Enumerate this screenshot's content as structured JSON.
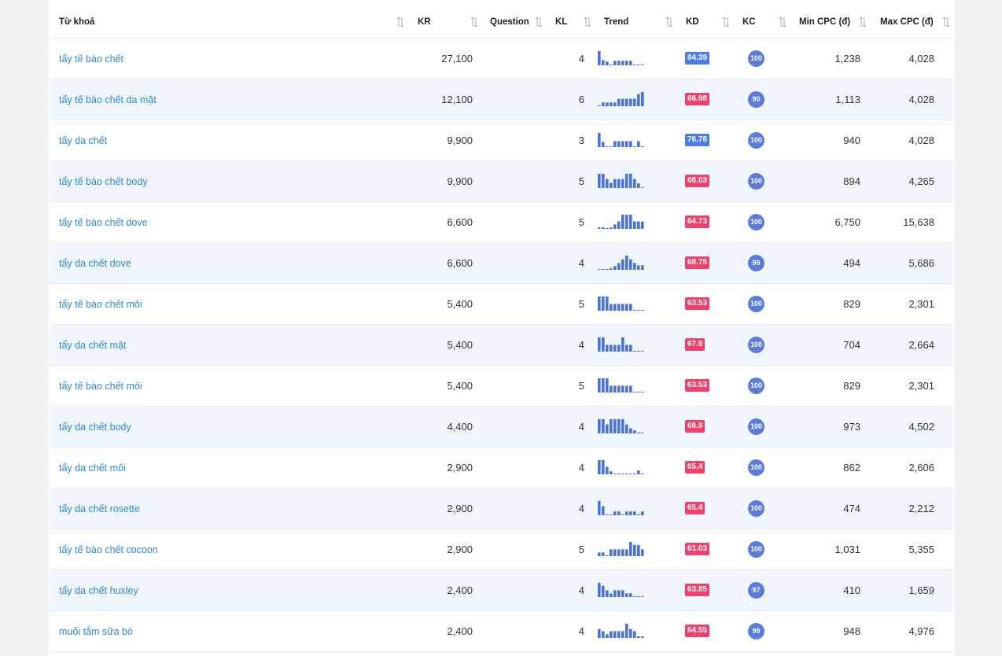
{
  "colors": {
    "kd_blue": "#4f7be8",
    "kd_red": "#f0416c",
    "kc_blue": "#5b7be1",
    "keyword": "#2d8ad4",
    "trend_bar": "#4a73d9"
  },
  "headers": {
    "keyword": "Từ khoá",
    "kr": "KR",
    "question": "Question",
    "kl": "KL",
    "trend": "Trend",
    "kd": "KD",
    "kc": "KC",
    "min_cpc": "Min CPC (đ)",
    "max_cpc": "Max CPC (đ)"
  },
  "rows": [
    {
      "keyword": "tẩy tế bào chết",
      "kr": "27,100",
      "kl": "4",
      "kd": "84.39",
      "kd_color": "#4f7be8",
      "kc": "100",
      "min_cpc": "1,238",
      "max_cpc": "4,028",
      "trend": [
        0.95,
        0.35,
        0.25,
        0.02,
        0.3,
        0.3,
        0.3,
        0.3,
        0.3,
        0.02,
        0.02,
        0.02
      ]
    },
    {
      "keyword": "tẩy tế bào chết da mặt",
      "kr": "12,100",
      "kl": "6",
      "kd": "66.98",
      "kd_color": "#f0416c",
      "kc": "90",
      "min_cpc": "1,113",
      "max_cpc": "4,028",
      "trend": [
        0.02,
        0.25,
        0.25,
        0.25,
        0.25,
        0.5,
        0.5,
        0.5,
        0.5,
        0.5,
        0.8,
        0.95
      ]
    },
    {
      "keyword": "tẩy da chết",
      "kr": "9,900",
      "kl": "3",
      "kd": "76.78",
      "kd_color": "#4f7be8",
      "kc": "100",
      "min_cpc": "940",
      "max_cpc": "4,028",
      "trend": [
        0.95,
        0.35,
        0.02,
        0.02,
        0.4,
        0.4,
        0.4,
        0.4,
        0.4,
        0.02,
        0.4,
        0.02
      ]
    },
    {
      "keyword": "tẩy tế bào chết body",
      "kr": "9,900",
      "kl": "5",
      "kd": "68.03",
      "kd_color": "#f0416c",
      "kc": "100",
      "min_cpc": "894",
      "max_cpc": "4,265",
      "trend": [
        0.95,
        0.95,
        0.6,
        0.35,
        0.6,
        0.6,
        0.6,
        0.95,
        0.95,
        0.6,
        0.3,
        0.02
      ]
    },
    {
      "keyword": "tẩy tế bào chết dove",
      "kr": "6,600",
      "kl": "5",
      "kd": "64.73",
      "kd_color": "#f0416c",
      "kc": "100",
      "min_cpc": "6,750",
      "max_cpc": "15,638",
      "trend": [
        0.1,
        0.1,
        0.02,
        0.1,
        0.3,
        0.5,
        0.95,
        0.95,
        0.95,
        0.5,
        0.5,
        0.5
      ]
    },
    {
      "keyword": "tẩy da chết dove",
      "kr": "6,600",
      "kl": "4",
      "kd": "68.75",
      "kd_color": "#f0416c",
      "kc": "99",
      "min_cpc": "494",
      "max_cpc": "5,686",
      "trend": [
        0.02,
        0.02,
        0.02,
        0.1,
        0.25,
        0.45,
        0.7,
        0.95,
        0.7,
        0.45,
        0.3,
        0.3
      ]
    },
    {
      "keyword": "tẩy tế bào chết môi",
      "kr": "5,400",
      "kl": "5",
      "kd": "63.53",
      "kd_color": "#f0416c",
      "kc": "100",
      "min_cpc": "829",
      "max_cpc": "2,301",
      "trend": [
        0.95,
        0.95,
        0.95,
        0.45,
        0.45,
        0.45,
        0.45,
        0.45,
        0.45,
        0.02,
        0.02,
        0.02
      ]
    },
    {
      "keyword": "tẩy da chết mặt",
      "kr": "5,400",
      "kl": "4",
      "kd": "67.9",
      "kd_color": "#f0416c",
      "kc": "100",
      "min_cpc": "704",
      "max_cpc": "2,664",
      "trend": [
        0.95,
        0.95,
        0.45,
        0.45,
        0.45,
        0.45,
        0.95,
        0.45,
        0.45,
        0.02,
        0.02,
        0.02
      ]
    },
    {
      "keyword": "tẩy tế bào chết môi",
      "kr": "5,400",
      "kl": "5",
      "kd": "63.53",
      "kd_color": "#f0416c",
      "kc": "100",
      "min_cpc": "829",
      "max_cpc": "2,301",
      "trend": [
        0.95,
        0.95,
        0.95,
        0.45,
        0.45,
        0.45,
        0.45,
        0.45,
        0.45,
        0.02,
        0.02,
        0.02
      ]
    },
    {
      "keyword": "tẩy da chết body",
      "kr": "4,400",
      "kl": "4",
      "kd": "66.9",
      "kd_color": "#f0416c",
      "kc": "100",
      "min_cpc": "973",
      "max_cpc": "4,502",
      "trend": [
        0.95,
        0.95,
        0.6,
        0.95,
        0.95,
        0.95,
        0.95,
        0.6,
        0.35,
        0.2,
        0.02,
        0.02
      ]
    },
    {
      "keyword": "tẩy da chết môi",
      "kr": "2,900",
      "kl": "4",
      "kd": "65.4",
      "kd_color": "#f0416c",
      "kc": "100",
      "min_cpc": "862",
      "max_cpc": "2,606",
      "trend": [
        0.95,
        0.95,
        0.5,
        0.2,
        0.02,
        0.02,
        0.02,
        0.02,
        0.02,
        0.02,
        0.25,
        0.02
      ]
    },
    {
      "keyword": "tẩy da chết rosette",
      "kr": "2,900",
      "kl": "4",
      "kd": "65.4",
      "kd_color": "#f0416c",
      "kc": "100",
      "min_cpc": "474",
      "max_cpc": "2,212",
      "trend": [
        0.95,
        0.6,
        0.02,
        0.02,
        0.25,
        0.25,
        0.02,
        0.25,
        0.25,
        0.25,
        0.02,
        0.25
      ]
    },
    {
      "keyword": "tẩy tế bào chết cocoon",
      "kr": "2,900",
      "kl": "5",
      "kd": "61.03",
      "kd_color": "#f0416c",
      "kc": "100",
      "min_cpc": "1,031",
      "max_cpc": "5,355",
      "trend": [
        0.25,
        0.25,
        0.02,
        0.45,
        0.45,
        0.45,
        0.45,
        0.45,
        0.95,
        0.75,
        0.75,
        0.45
      ]
    },
    {
      "keyword": "tẩy da chết huxley",
      "kr": "2,400",
      "kl": "4",
      "kd": "63.85",
      "kd_color": "#f0416c",
      "kc": "97",
      "min_cpc": "410",
      "max_cpc": "1,659",
      "trend": [
        0.95,
        0.75,
        0.45,
        0.25,
        0.45,
        0.45,
        0.45,
        0.25,
        0.25,
        0.02,
        0.02,
        0.02
      ]
    },
    {
      "keyword": "muối tắm sữa bò",
      "kr": "2,400",
      "kl": "4",
      "kd": "64.55",
      "kd_color": "#f0416c",
      "kc": "99",
      "min_cpc": "948",
      "max_cpc": "4,976",
      "trend": [
        0.6,
        0.45,
        0.25,
        0.45,
        0.45,
        0.45,
        0.45,
        0.95,
        0.6,
        0.45,
        0.1,
        0.1
      ]
    }
  ]
}
